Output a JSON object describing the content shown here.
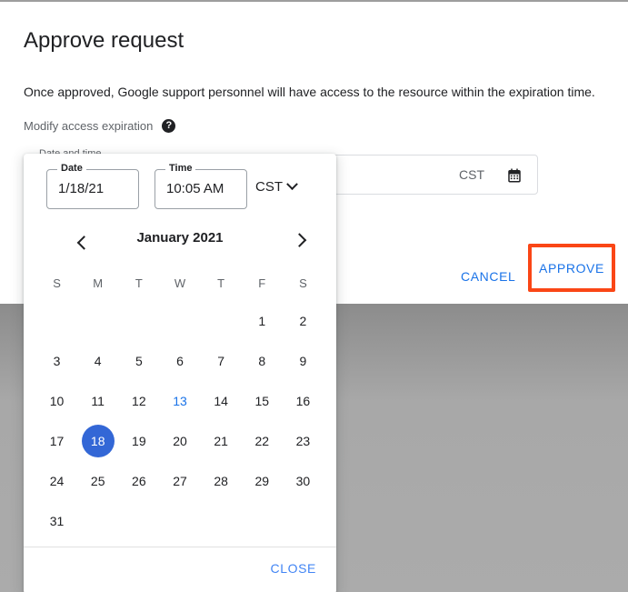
{
  "dialog": {
    "title": "Approve request",
    "description": "Once approved, Google support personnel will have access to the resource within the expiration time.",
    "modify_label": "Modify access expiration",
    "help_icon": "help-icon",
    "help_glyph": "?",
    "field": {
      "label": "Date and time",
      "timezone": "CST",
      "calendar_icon": "calendar-icon"
    },
    "actions": {
      "cancel_label": "CANCEL",
      "approve_label": "APPROVE",
      "approve_highlight_color": "#fa4616"
    }
  },
  "picker": {
    "date": {
      "label": "Date",
      "value": "1/18/21"
    },
    "time": {
      "label": "Time",
      "value": "10:05 AM"
    },
    "timezone": {
      "value": "CST",
      "icon": "chevron-down-icon"
    },
    "nav": {
      "prev_icon": "chevron-left-icon",
      "next_icon": "chevron-right-icon",
      "month_title": "January 2021"
    },
    "weekdays": [
      "S",
      "M",
      "T",
      "W",
      "T",
      "F",
      "S"
    ],
    "weeks": [
      [
        "",
        "",
        "",
        "",
        "",
        "1",
        "2"
      ],
      [
        "3",
        "4",
        "5",
        "6",
        "7",
        "8",
        "9"
      ],
      [
        "10",
        "11",
        "12",
        "13",
        "14",
        "15",
        "16"
      ],
      [
        "17",
        "18",
        "19",
        "20",
        "21",
        "22",
        "23"
      ],
      [
        "24",
        "25",
        "26",
        "27",
        "28",
        "29",
        "30"
      ],
      [
        "31",
        "",
        "",
        "",
        "",
        "",
        ""
      ]
    ],
    "today": "13",
    "selected": "18",
    "selected_color": "#3367d6",
    "today_color": "#1a73e8",
    "close_label": "CLOSE"
  }
}
